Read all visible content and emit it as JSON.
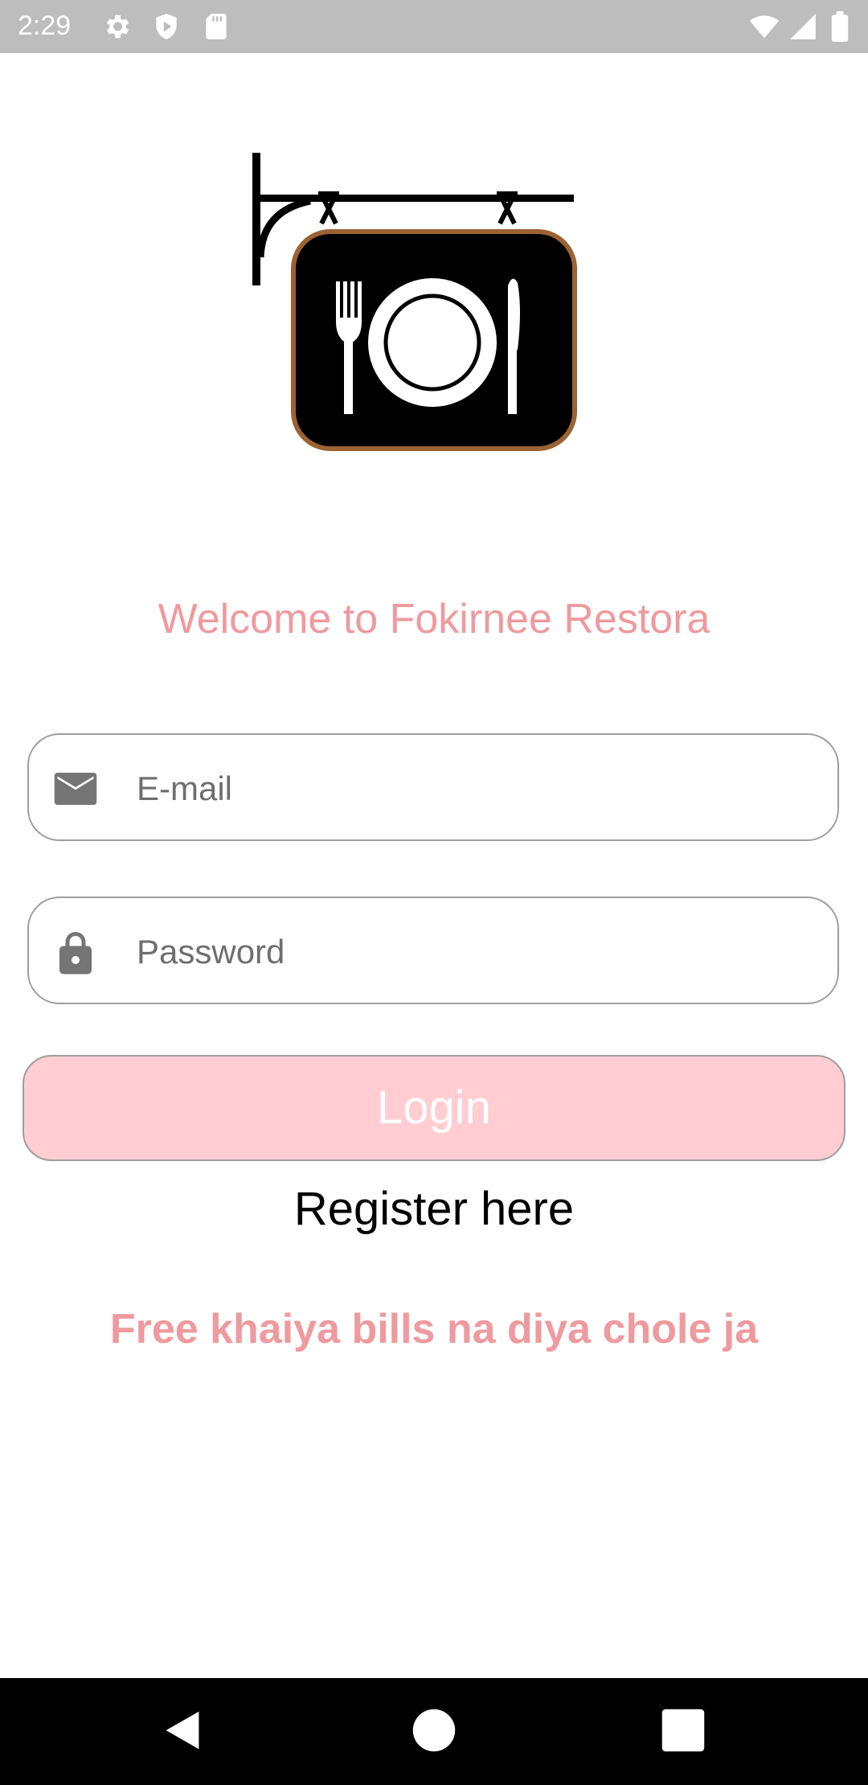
{
  "status_bar": {
    "time": "2:29",
    "icons": [
      "settings-icon",
      "shield-icon",
      "sd-card-icon",
      "wifi-icon",
      "signal-icon",
      "battery-icon"
    ]
  },
  "logo": {
    "icon": "restaurant-sign-icon",
    "frame_color": "#9c6233"
  },
  "welcome_text": "Welcome to Fokirnee Restora",
  "email_field": {
    "icon": "mail-icon",
    "placeholder": "E-mail",
    "value": ""
  },
  "password_field": {
    "icon": "lock-icon",
    "placeholder": "Password",
    "value": ""
  },
  "login_button": {
    "label": "Login",
    "background": "#ffcdd2"
  },
  "register_link": "Register here",
  "footer_text": "Free khaiya bills na diya chole ja",
  "accent_color": "#ee9a9f",
  "nav_bar": {
    "icons": [
      "back-icon",
      "home-icon",
      "recents-icon"
    ]
  }
}
